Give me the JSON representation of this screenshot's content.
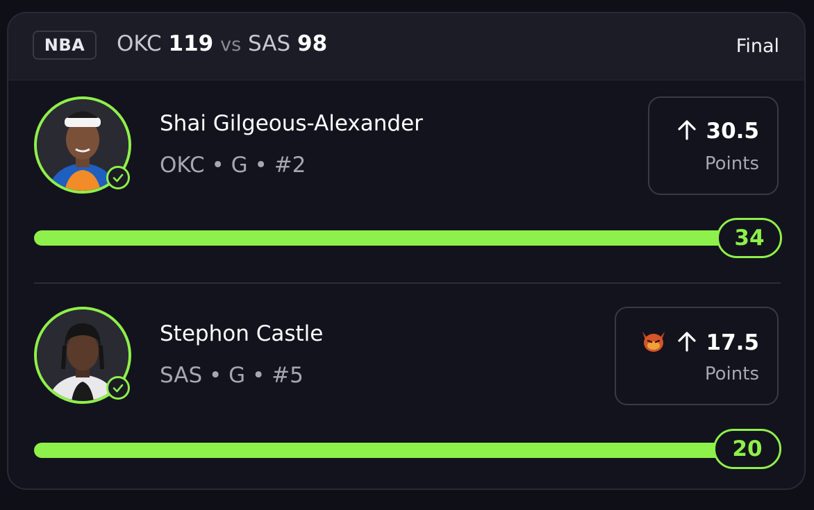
{
  "header": {
    "league": "NBA",
    "home_team": "OKC",
    "home_score": "119",
    "vs": "vs",
    "away_team": "SAS",
    "away_score": "98",
    "status": "Final"
  },
  "accent_color": "#8ef04a",
  "players": [
    {
      "name": "Shai Gilgeous-Alexander",
      "meta": "OKC • G • #2",
      "direction_icon": "arrow-up-icon",
      "line": "30.5",
      "stat": "Points",
      "result": "34",
      "progress": 1.0,
      "hit": true
    },
    {
      "name": "Stephon Castle",
      "meta": "SAS • G • #5",
      "tag_icon": "devil-emoji-icon",
      "direction_icon": "arrow-up-icon",
      "line": "17.5",
      "stat": "Points",
      "result": "20",
      "progress": 1.0,
      "hit": true
    }
  ]
}
